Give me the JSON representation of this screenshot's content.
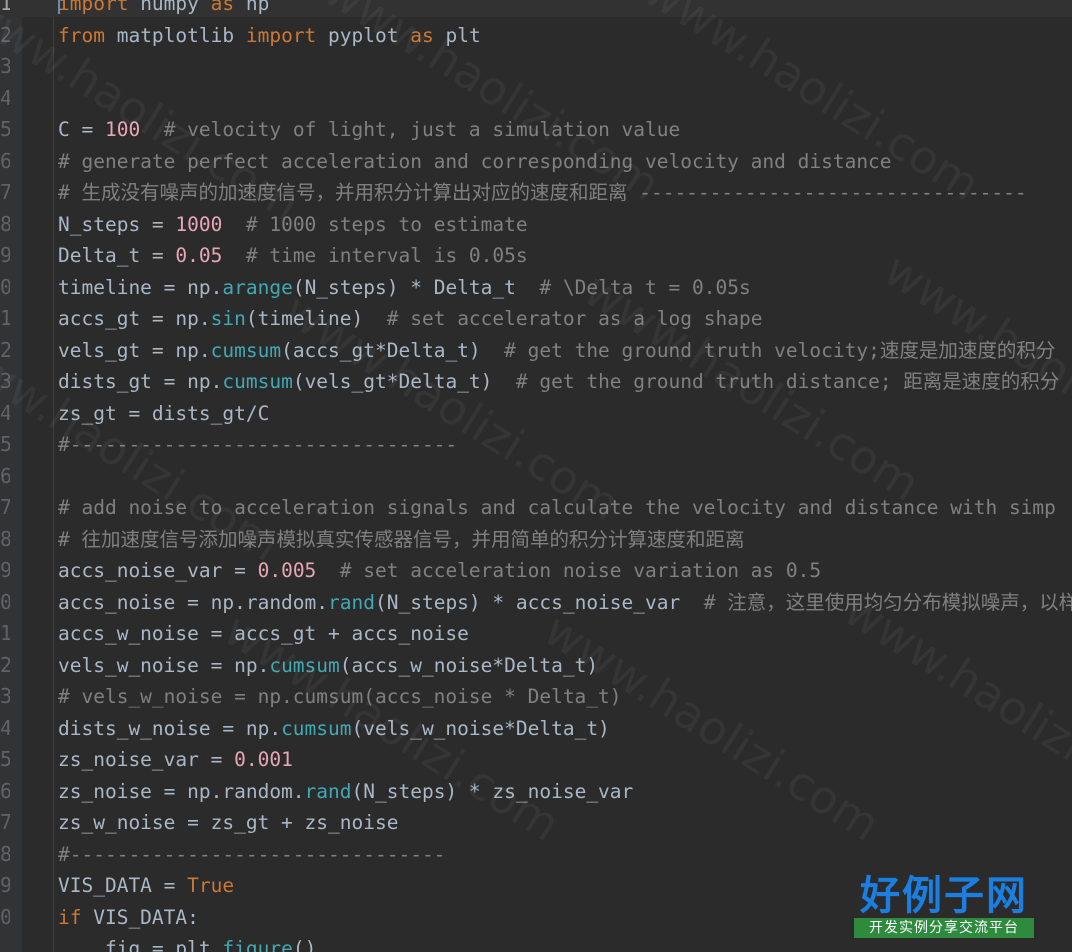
{
  "gutter_numbers": [
    "1",
    "2",
    "3",
    "4",
    "5",
    "6",
    "7",
    "8",
    "9",
    "0",
    "1",
    "2",
    "3",
    "4",
    "5",
    "6",
    "7",
    "8",
    "9",
    "0",
    "1",
    "2",
    "3",
    "4",
    "5",
    "6",
    "7",
    "8",
    "9",
    "0",
    ""
  ],
  "code_lines": [
    [
      [
        "kw",
        "import"
      ],
      [
        "p",
        " numpy "
      ],
      [
        "kw",
        "as"
      ],
      [
        "p",
        " np"
      ]
    ],
    [
      [
        "kw",
        "from"
      ],
      [
        "p",
        " matplotlib "
      ],
      [
        "kw",
        "import"
      ],
      [
        "p",
        " pyplot "
      ],
      [
        "kw",
        "as"
      ],
      [
        "p",
        " plt"
      ]
    ],
    [],
    [],
    [
      [
        "p",
        "C = "
      ],
      [
        "cnum",
        "100"
      ],
      [
        "p",
        "  "
      ],
      [
        "cmt",
        "# velocity of light, just a simulation value"
      ]
    ],
    [
      [
        "cmt",
        "# generate perfect acceleration and corresponding velocity and distance"
      ]
    ],
    [
      [
        "cmt",
        "# 生成没有噪声的加速度信号，并用积分计算出对应的速度和距离 ---------------------------------"
      ]
    ],
    [
      [
        "p",
        "N_steps = "
      ],
      [
        "cnum",
        "1000"
      ],
      [
        "p",
        "  "
      ],
      [
        "cmt",
        "# 1000 steps to estimate"
      ]
    ],
    [
      [
        "p",
        "Delta_t = "
      ],
      [
        "cnum",
        "0.05"
      ],
      [
        "p",
        "  "
      ],
      [
        "cmt",
        "# time interval is 0.05s"
      ]
    ],
    [
      [
        "p",
        "timeline = np."
      ],
      [
        "fn",
        "arange"
      ],
      [
        "p",
        "(N_steps) * Delta_t  "
      ],
      [
        "cmt",
        "# \\Delta t = 0.05s"
      ]
    ],
    [
      [
        "p",
        "accs_gt = np."
      ],
      [
        "fn",
        "sin"
      ],
      [
        "p",
        "(timeline)  "
      ],
      [
        "cmt",
        "# set accelerator as a log shape"
      ]
    ],
    [
      [
        "p",
        "vels_gt = np."
      ],
      [
        "fn",
        "cumsum"
      ],
      [
        "p",
        "(accs_gt*Delta_t)  "
      ],
      [
        "cmt",
        "# get the ground truth velocity;速度是加速度的积分"
      ]
    ],
    [
      [
        "p",
        "dists_gt = np."
      ],
      [
        "fn",
        "cumsum"
      ],
      [
        "p",
        "(vels_gt*Delta_t)  "
      ],
      [
        "cmt",
        "# get the ground truth distance; 距离是速度的积分"
      ]
    ],
    [
      [
        "p",
        "zs_gt = dists_gt/C"
      ]
    ],
    [
      [
        "cmt",
        "#---------------------------------"
      ]
    ],
    [],
    [
      [
        "cmt",
        "# add noise to acceleration signals and calculate the velocity and distance with simp"
      ]
    ],
    [
      [
        "cmt",
        "# 往加速度信号添加噪声模拟真实传感器信号，并用简单的积分计算速度和距离"
      ]
    ],
    [
      [
        "p",
        "accs_noise_var = "
      ],
      [
        "cnum",
        "0.005"
      ],
      [
        "p",
        "  "
      ],
      [
        "cmt",
        "# set acceleration noise variation as 0.5"
      ]
    ],
    [
      [
        "p",
        "accs_noise = np.random."
      ],
      [
        "fn",
        "rand"
      ],
      [
        "p",
        "(N_steps) * accs_noise_var  "
      ],
      [
        "cmt",
        "# 注意，这里使用均匀分布模拟噪声，以样"
      ]
    ],
    [
      [
        "p",
        "accs_w_noise = accs_gt + accs_noise"
      ]
    ],
    [
      [
        "p",
        "vels_w_noise = np."
      ],
      [
        "fn",
        "cumsum"
      ],
      [
        "p",
        "(accs_w_noise*Delta_t)"
      ]
    ],
    [
      [
        "cmt",
        "# vels_w_noise = np.cumsum(accs_noise * Delta_t)"
      ]
    ],
    [
      [
        "p",
        "dists_w_noise = np."
      ],
      [
        "fn",
        "cumsum"
      ],
      [
        "p",
        "(vels_w_noise*Delta_t)"
      ]
    ],
    [
      [
        "p",
        "zs_noise_var = "
      ],
      [
        "cnum",
        "0.001"
      ]
    ],
    [
      [
        "p",
        "zs_noise = np.random."
      ],
      [
        "fn",
        "rand"
      ],
      [
        "p",
        "(N_steps) * zs_noise_var"
      ]
    ],
    [
      [
        "p",
        "zs_w_noise = zs_gt + zs_noise"
      ]
    ],
    [
      [
        "cmt",
        "#--------------------------------"
      ]
    ],
    [
      [
        "p",
        "VIS_DATA = "
      ],
      [
        "tru",
        "True"
      ]
    ],
    [
      [
        "kw",
        "if"
      ],
      [
        "p",
        " VIS_DATA:"
      ]
    ],
    [
      [
        "p",
        "    fig = plt."
      ],
      [
        "fn",
        "figure"
      ],
      [
        "p",
        "()"
      ]
    ]
  ],
  "watermark_text": "www.haolizi.com",
  "logo": {
    "main": "好例子网",
    "sub": "开发实例分享交流平台"
  },
  "colors": {
    "background": "#2b2b2b",
    "keyword": "#cc7832",
    "comment": "#808080",
    "function": "#40a9b4",
    "number": "#e8a5b4",
    "plain": "#a9b7c6",
    "logo_blue": "#1a7fe0",
    "logo_green": "#2e8b3e"
  }
}
